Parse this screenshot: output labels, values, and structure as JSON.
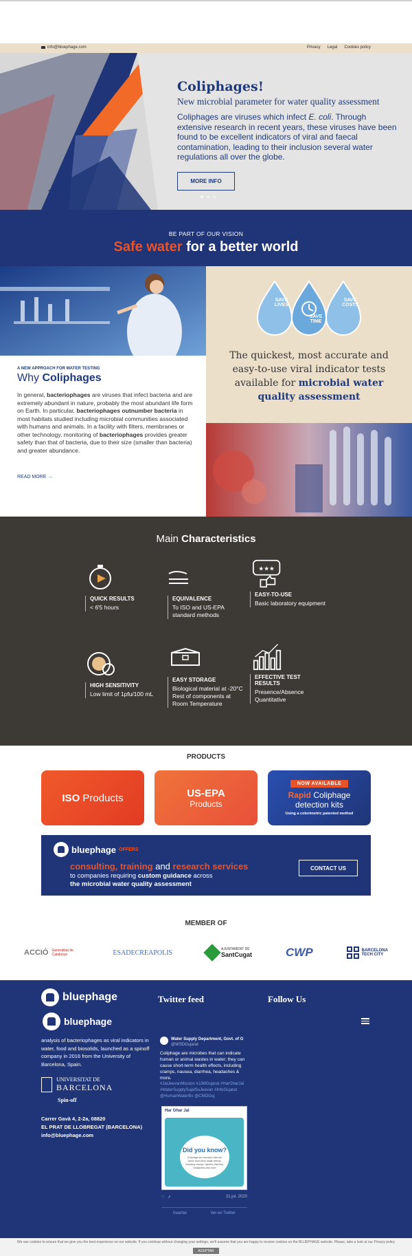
{
  "topbar": {
    "email": "info@bluephage.com",
    "links": [
      "Privacy",
      "Legal",
      "Cookies policy"
    ]
  },
  "hero": {
    "title": "Coliphages!",
    "subtitle": "New microbial parameter for water quality assessment",
    "body_1": "Coliphages are viruses which infect ",
    "body_italic": "E. coli",
    "body_2": ". Through extensive research in recent years, these viruses have been found to be excellent indicators of viral and faecal contamination, leading to their inclusion several water regulations all over the globe.",
    "button": "MORE INFO"
  },
  "vision": {
    "kicker": "BE PART OF OUR VISION",
    "headline_accent": "Safe water",
    "headline_rest": " for a better world"
  },
  "badges": {
    "left": "SAVE LIVES",
    "middle": "SAVE TIME",
    "right": "SAVE COSTS"
  },
  "beige_text": {
    "plain": "The quickest, most accurate and easy-to-use viral indicator tests available for ",
    "bold": "microbial water quality assessment"
  },
  "why": {
    "kicker": "A NEW APPROACH FOR WATER TESTING",
    "title_plain": "Why ",
    "title_bold": "Coliphages",
    "p1": "In general, ",
    "p1b": "bacteriophages",
    "p2": " are viruses that infect bacteria and are extremely abundant in nature, probably the most abundant life form on Earth. In particular, ",
    "p2b": "bacteriophages outnumber bacteria",
    "p3": " in most habitats studied including microbial communities associated with humans and animals. In a facility with filters, membranes or other technology, monitoring of ",
    "p3b": "bacteriophages",
    "p4": " provides greater safety than that of bacteria, due to their size (smaller than bacteria) and greater abundance.",
    "read_more": "READ MORE →"
  },
  "characteristics": {
    "title_plain": "Main ",
    "title_bold": "Characteristics",
    "items": [
      {
        "title": "QUICK RESULTS",
        "desc": "< 6'5 hours"
      },
      {
        "title": "EQUIVALENCE",
        "desc": "To ISO and US-EPA standard methods"
      },
      {
        "title": "EASY-TO-USE",
        "desc": "Basic laboratory equipment"
      },
      {
        "title": "HIGH SENSITIVITY",
        "desc": "Low limit of 1pfu/100 mL"
      },
      {
        "title": "EASY STORAGE",
        "desc": "Biological material at -20°C Rest of components at Room Temperature"
      },
      {
        "title": "EFFECTIVE TEST RESULTS",
        "desc": "Presence/Absence Quantitative"
      }
    ]
  },
  "products": {
    "heading": "PRODUCTS",
    "iso": {
      "bold": "ISO",
      "rest": " Products"
    },
    "usepa": {
      "line1": "US-EPA",
      "line2": "Products"
    },
    "rapid": {
      "badge": "NOW AVAILABLE",
      "bold": "Rapid",
      "rest": " Coliphage",
      "line2": "detection kits",
      "note": "Using a colorimetric patented method"
    }
  },
  "offer": {
    "brand": "bluephage",
    "offers": "OFFERS",
    "line1_a": "consulting, training",
    "line1_b": " and ",
    "line1_c": "research services",
    "line2_a": "to companies requiring ",
    "line2_b": "custom guidance",
    "line2_c": " across",
    "line3": "the microbial water quality assessment",
    "button": "CONTACT US"
  },
  "member": {
    "heading": "MEMBER OF",
    "logos": [
      "ACCIÓ",
      "Generalitat de Catalunya",
      "ESADECREAPOLIS",
      "AJUNTAMENT DE",
      "SantCugat",
      "CWP",
      "BARCELONA",
      "TECH CITY"
    ]
  },
  "footer": {
    "brand": "bluephage",
    "twitter_heading": "Twitter feed",
    "follow_heading": "Follow Us",
    "about": "analysis of bacteriophages as viral indicators in water, food and biosolids, launched as a spinoff company in 2016 from the University of Barcelona, Spain.",
    "uni_line1": "UNIVERSITAT DE",
    "uni_line2": "BARCELONA",
    "spinoff": "Spin-off",
    "addr1": "Carrer Gavà 4, 2-2a, 08820",
    "addr2": "EL PRAT DE LLOBREGAT (BARCELONA)",
    "addr3": "info@bluephage.com",
    "tweet_account": "Water Supply Department, Govt. of G",
    "tweet_handle": "@WSDGujarat",
    "tweet_text": "Coliphage are microbes that can indicate human or animal wastes in water; they can cause short-term health effects, including cramps, nausea, diarrhea, headaches & more.",
    "tweet_tags": "#JalJeevanMission #JJMGujarat #HarGharJal #WaterSupplySujalSuJeevan #InfoGujarat @HumanWaterBo @CMOGuj",
    "tweet_card_tag": "Har Ghar Jal",
    "tweet_card_title": "Did you know?",
    "tweet_card_text": "Coliphage are microbes that can cause short-term health effects, including cramps, nausea, diarrhea, headaches and more",
    "tweet_date": "21 jul. 2020",
    "embed": "Insertar",
    "view_twitter": "Ver en Twitter"
  },
  "cookie": {
    "text": "We use cookies to ensure that we give you the best experience on our website. If you continue without changing your settings, we'll assume that you are happy to receive cookies on the BLUEPHAGE website. Please, take a look at our Privacy policy",
    "accept": "ACEPTAR"
  }
}
